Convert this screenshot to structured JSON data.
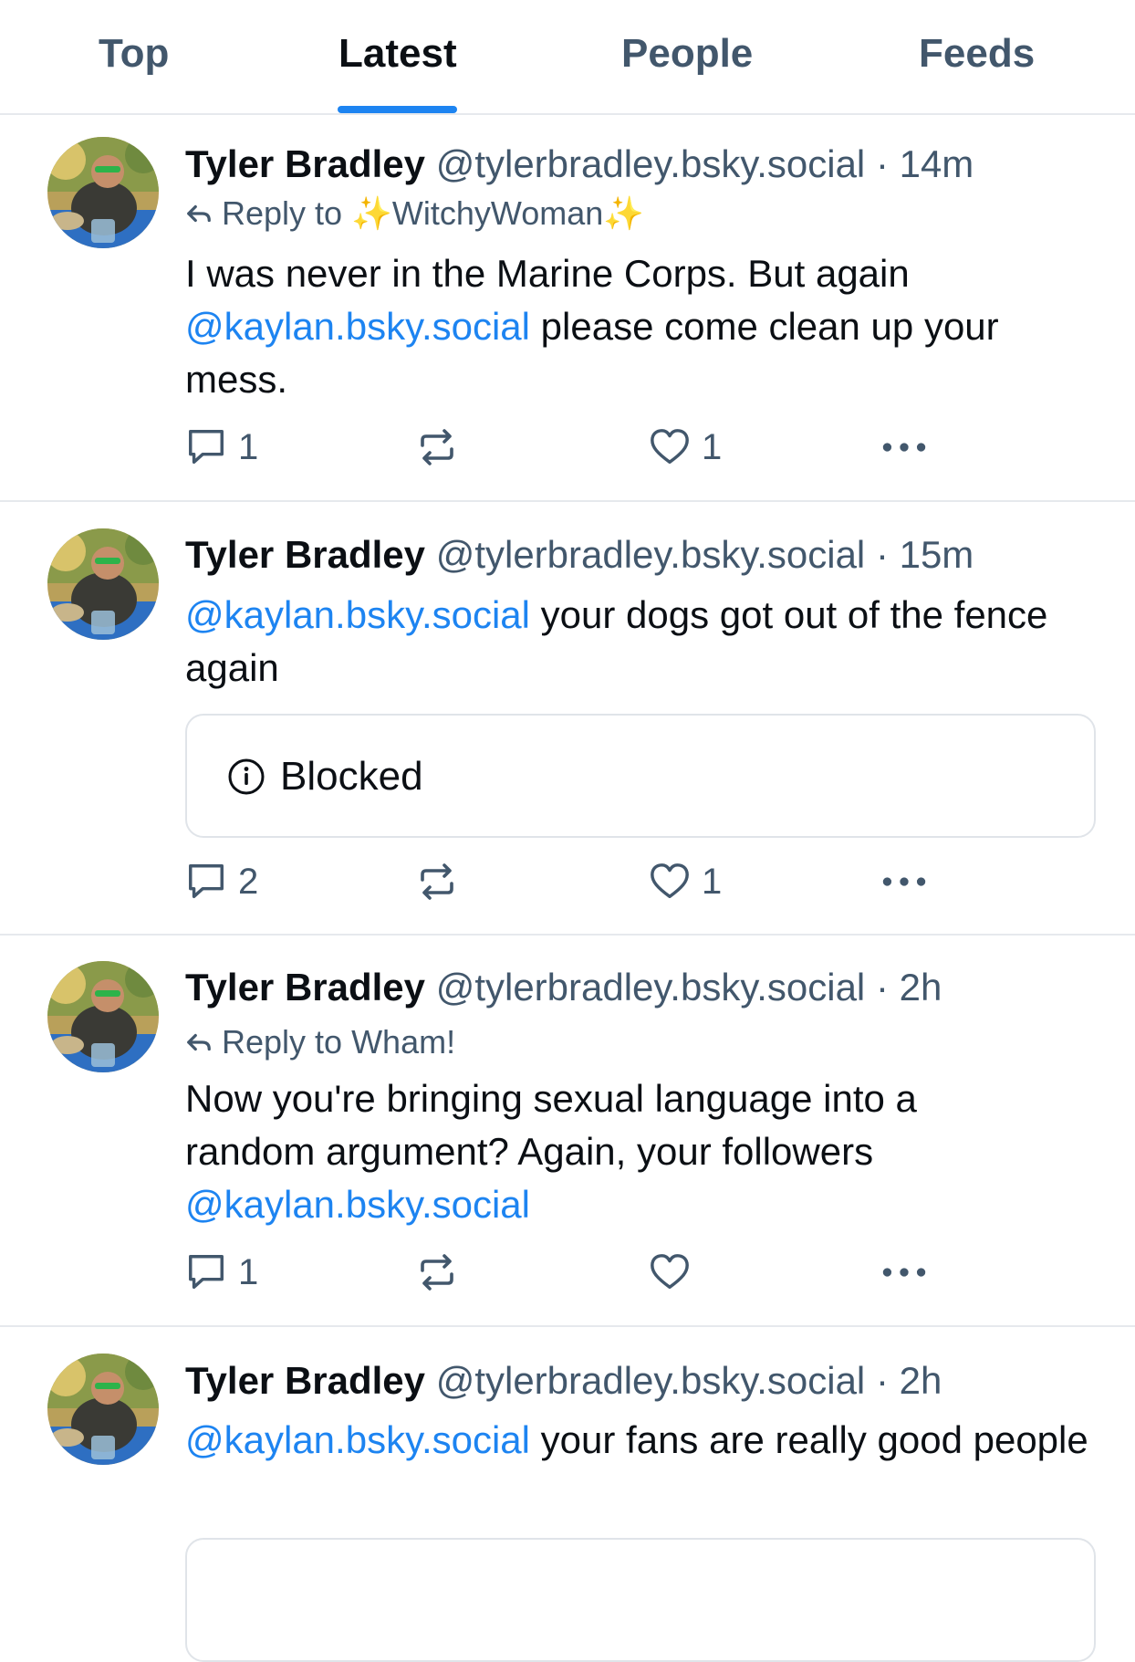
{
  "tabs": [
    {
      "label": "Top",
      "active": false
    },
    {
      "label": "Latest",
      "active": true
    },
    {
      "label": "People",
      "active": false
    },
    {
      "label": "Feeds",
      "active": false
    }
  ],
  "colors": {
    "accent": "#1d84f1",
    "muted": "#42576c",
    "divider": "#e6e9ed",
    "text": "#0b0f14"
  },
  "posts": [
    {
      "author": "Tyler Bradley",
      "handle": "@tylerbradley.bsky.social",
      "time": "· 14m",
      "reply_to": "Reply to ✨WitchyWoman✨",
      "body_mention": "@kaylan.bsky.social",
      "body_before": "I was never in the Marine Corps. But again",
      "body_after": "please come clean up your mess.",
      "reply_count": "1",
      "like_count": "1"
    },
    {
      "author": "Tyler Bradley",
      "handle": "@tylerbradley.bsky.social",
      "time": "· 15m",
      "body_mention": "@kaylan.bsky.social",
      "body_after": "your dogs got out of the fence again",
      "embed": {
        "icon": "info-icon",
        "label": "Blocked"
      },
      "reply_count": "2",
      "like_count": "1"
    },
    {
      "author": "Tyler Bradley",
      "handle": "@tylerbradley.bsky.social",
      "time": "· 2h",
      "reply_to": "Reply to Wham!",
      "body_before": "Now you're bringing sexual language into a random argument? Again, your followers",
      "body_mention": "@kaylan.bsky.social",
      "reply_count": "1",
      "like_count": ""
    },
    {
      "author": "Tyler Bradley",
      "handle": "@tylerbradley.bsky.social",
      "time": "· 2h",
      "body_mention": "@kaylan.bsky.social",
      "body_after": "your fans are really good people"
    }
  ]
}
